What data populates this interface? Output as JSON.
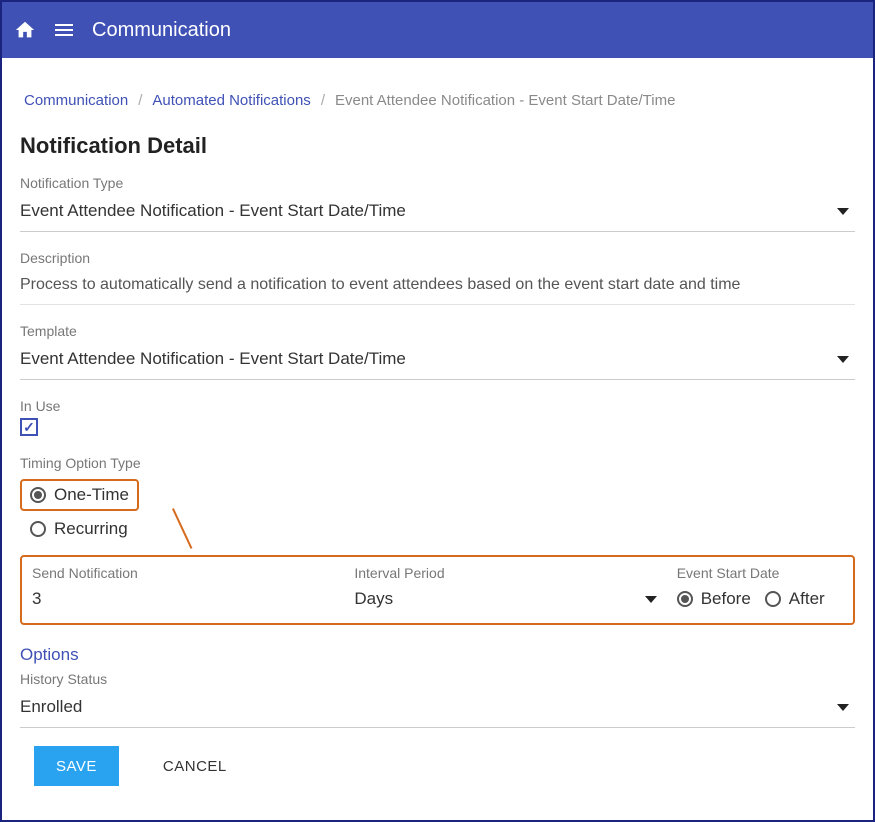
{
  "header": {
    "title": "Communication"
  },
  "breadcrumb": {
    "link1": "Communication",
    "link2": "Automated Notifications",
    "current": "Event Attendee Notification - Event Start Date/Time"
  },
  "page": {
    "title": "Notification Detail"
  },
  "fields": {
    "notification_type": {
      "label": "Notification Type",
      "value": "Event Attendee Notification - Event Start Date/Time"
    },
    "description": {
      "label": "Description",
      "value": "Process to automatically send a notification to event attendees based on the event start date and time"
    },
    "template": {
      "label": "Template",
      "value": "Event Attendee Notification - Event Start Date/Time"
    },
    "in_use": {
      "label": "In Use",
      "checked": true
    },
    "timing_option_type": {
      "label": "Timing Option Type",
      "options": {
        "one_time": "One-Time",
        "recurring": "Recurring"
      },
      "selected": "one_time"
    },
    "send_notification": {
      "label": "Send Notification",
      "value": "3"
    },
    "interval_period": {
      "label": "Interval Period",
      "value": "Days"
    },
    "event_start_date": {
      "label": "Event Start Date",
      "options": {
        "before": "Before",
        "after": "After"
      },
      "selected": "before"
    },
    "options_heading": "Options",
    "history_status": {
      "label": "History Status",
      "value": "Enrolled"
    }
  },
  "buttons": {
    "save": "SAVE",
    "cancel": "CANCEL"
  }
}
